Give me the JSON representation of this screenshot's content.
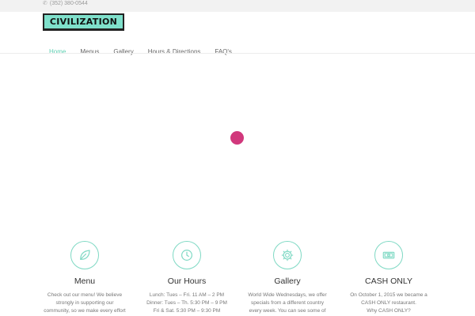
{
  "topbar": {
    "phone": "(352) 380-0544",
    "phone_icon": "phone-icon"
  },
  "header": {
    "logo_text": "CIVILIZATION"
  },
  "nav": {
    "items": [
      {
        "label": "Home",
        "active": true
      },
      {
        "label": "Menus",
        "active": false
      },
      {
        "label": "Gallery",
        "active": false
      },
      {
        "label": "Hours & Directions",
        "active": false
      },
      {
        "label": "FAQ's",
        "active": false
      }
    ]
  },
  "colors": {
    "accent": "#5ccfb1",
    "logo_bg": "#7fe0cb",
    "loader": "#d1387c",
    "topbar": "#f2f2f2"
  },
  "features": [
    {
      "icon": "leaf-icon",
      "title": "Menu",
      "desc": [
        "Check out our menu! We believe",
        "strongly in supporting our",
        "community, so we make every effort"
      ]
    },
    {
      "icon": "clock-icon",
      "title": "Our Hours",
      "desc": [
        "Lunch: Tues – Fri. 11 AM – 2 PM",
        "Dinner: Tues – Th. 5:30 PM – 9 PM",
        "Fri & Sat. 5:30 PM – 9:30 PM"
      ]
    },
    {
      "icon": "gear-icon",
      "title": "Gallery",
      "desc": [
        "World Wide Wednesdays, we offer",
        "specials from a different country",
        "every week. You can see some of"
      ]
    },
    {
      "icon": "cash-icon",
      "title": "CASH ONLY",
      "desc": [
        "On October 1, 2015 we became a",
        "CASH ONLY restaurant.",
        "Why CASH ONLY?"
      ]
    }
  ]
}
